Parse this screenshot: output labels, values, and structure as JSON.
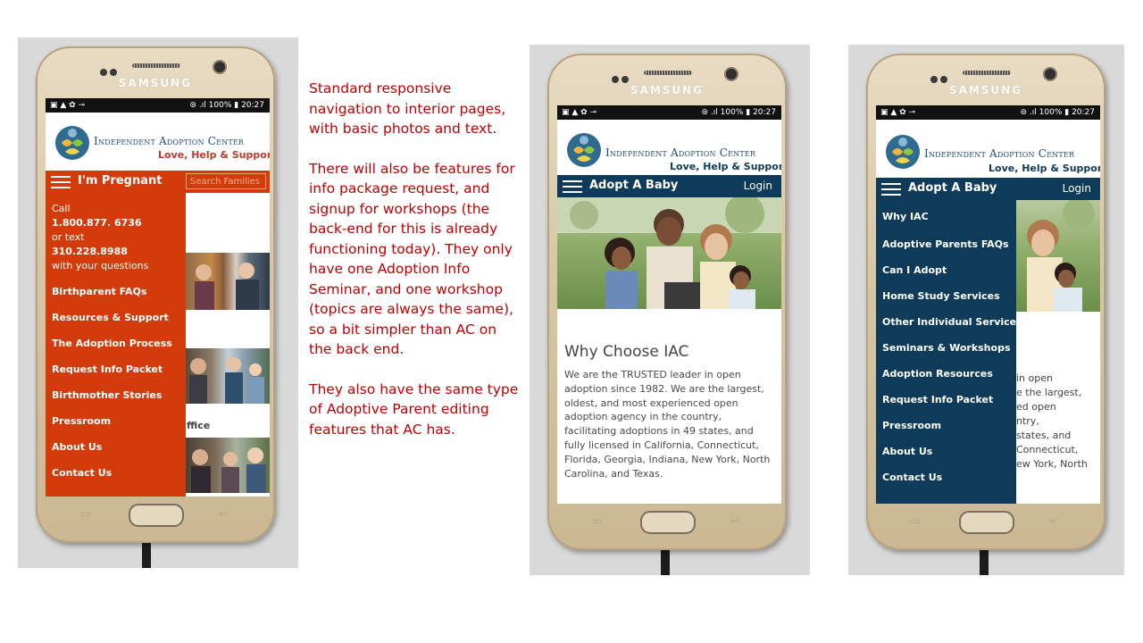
{
  "notes": {
    "paragraph_1": "Standard responsive navigation to interior pages, with basic photos and text.",
    "paragraph_2": "There will also be features for info package request, and signup for workshops (the back-end for this is already functioning today). They only have one Adoption Info Seminar, and one workshop (topics are always the same), so a bit simpler than AC on the back end.",
    "paragraph_3": "They also have the same type of Adoptive Parent editing features that AC has."
  },
  "device": {
    "brand": "SAMSUNG",
    "status_battery": "100%",
    "status_time": "20:27"
  },
  "logo": {
    "title": "Independent Adoption Center",
    "tagline": "Love, Help & Support"
  },
  "colors": {
    "orange": "#d43b0b",
    "navy": "#0e3b59",
    "tagline_red": "#c0392b"
  },
  "phone1": {
    "nav_title": "I'm Pregnant",
    "search_placeholder": "Search Families",
    "call_label": "Call",
    "call_number": "1.800.877. 6736",
    "text_label": "or text",
    "text_number": "310.228.8988",
    "questions_label": "with your questions",
    "menu": [
      "Birthparent FAQs",
      "Resources & Support",
      "The Adoption Process",
      "Request Info Packet",
      "Birthmother Stories",
      "Pressroom",
      "About Us",
      "Contact Us"
    ],
    "fragment": "ffice"
  },
  "phone2": {
    "nav_title": "Adopt A Baby",
    "login": "Login",
    "article_title": "Why Choose IAC",
    "article_body": "We are the TRUSTED leader in open adoption since 1982. We are the largest, oldest, and most experienced open adoption agency in the country, facilitating adoptions in 49 states, and fully licensed in California, Connecticut, Florida, Georgia, Indiana, New York, North Carolina, and Texas."
  },
  "phone3": {
    "nav_title": "Adopt A Baby",
    "login": "Login",
    "menu": [
      "Why IAC",
      "Adoptive Parents FAQs",
      "Can I Adopt",
      "Home Study Services",
      "Other Individual Services",
      "Seminars & Workshops",
      "Adoption Resources",
      "Request Info Packet",
      "Pressroom",
      "About Us",
      "Contact Us"
    ],
    "fragments": [
      "in open",
      "e the largest,",
      "ed open",
      "ntry,",
      "states, and",
      "Connecticut,",
      "ew York, North"
    ]
  }
}
